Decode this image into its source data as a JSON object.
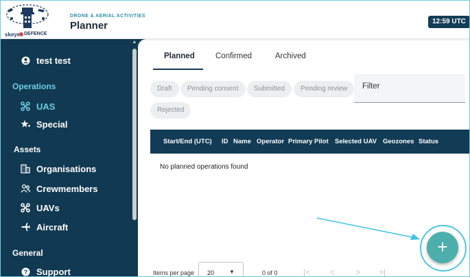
{
  "header": {
    "kicker": "DRONE & AERIAL ACTIVITIES",
    "title": "Planner",
    "time": "12:59 UTC",
    "logo": {
      "brand": "skeyes",
      "partner": "DEFENCE"
    }
  },
  "sidebar": {
    "user": "test test",
    "sections": {
      "operations": "Operations",
      "assets": "Assets",
      "general": "General"
    },
    "items": {
      "uas": "UAS",
      "special": "Special",
      "organisations": "Organisations",
      "crewmembers": "Crewmembers",
      "uavs": "UAVs",
      "aircraft": "Aircraft",
      "support": "Support"
    }
  },
  "tabs": [
    "Planned",
    "Confirmed",
    "Archived"
  ],
  "chips": [
    "Draft",
    "Pending consent",
    "Submitted",
    "Pending review",
    "Rejected"
  ],
  "filter": {
    "placeholder": "Filter"
  },
  "table": {
    "columns": [
      "Start/End (UTC)",
      "ID",
      "Name",
      "Operator",
      "Primary Pilot",
      "Selected UAV",
      "Geozones",
      "Status"
    ],
    "empty": "No planned operations found"
  },
  "pager": {
    "label": "Items per page",
    "page_size": "20",
    "range": "0 of 0",
    "first": "|<",
    "prev": "<",
    "next": ">",
    "last": ">|"
  },
  "fab": {
    "label": "+"
  },
  "colors": {
    "navy": "#113a52",
    "accent": "#6ecde0",
    "fab": "#4dafab"
  }
}
